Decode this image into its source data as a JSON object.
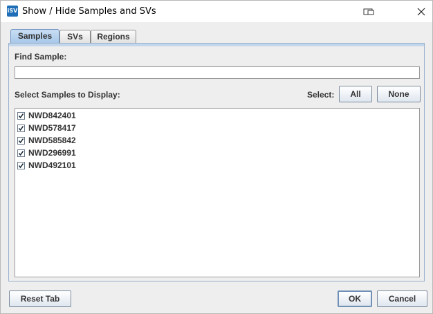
{
  "window": {
    "title": "Show / Hide Samples and SVs",
    "icon_text": "iSV"
  },
  "tabs": [
    {
      "label": "Samples",
      "active": true
    },
    {
      "label": "SVs",
      "active": false
    },
    {
      "label": "Regions",
      "active": false
    }
  ],
  "samples_tab": {
    "find_label": "Find Sample:",
    "find_value": "",
    "select_display_label": "Select Samples to Display:",
    "select_label": "Select:",
    "all_button": "All",
    "none_button": "None",
    "samples": [
      {
        "name": "NWD842401",
        "checked": true
      },
      {
        "name": "NWD578417",
        "checked": true
      },
      {
        "name": "NWD585842",
        "checked": true
      },
      {
        "name": "NWD296991",
        "checked": true
      },
      {
        "name": "NWD492101",
        "checked": true
      }
    ]
  },
  "footer": {
    "reset_button": "Reset Tab",
    "ok_button": "OK",
    "cancel_button": "Cancel"
  },
  "icons": {
    "app": "isv-app-icon",
    "restore": "restore-window-icon",
    "close": "close-icon",
    "check": "checkmark-icon"
  }
}
